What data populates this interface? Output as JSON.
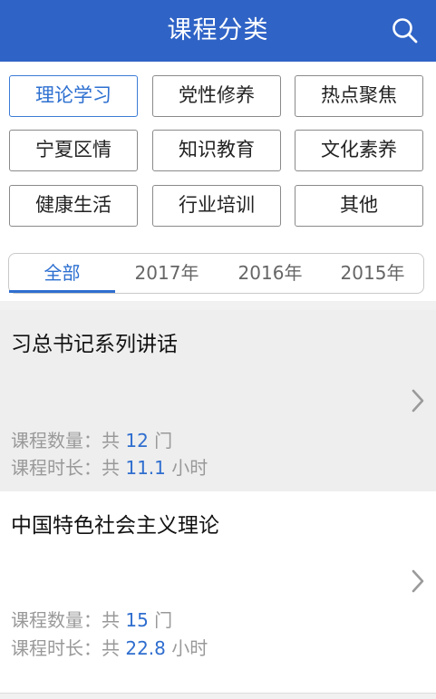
{
  "header": {
    "title": "课程分类",
    "bg_color": "#2f63c6"
  },
  "search": {
    "icon": "search-icon"
  },
  "categories": [
    {
      "label": "理论学习",
      "active": true
    },
    {
      "label": "党性修养",
      "active": false
    },
    {
      "label": "热点聚焦",
      "active": false
    },
    {
      "label": "宁夏区情",
      "active": false
    },
    {
      "label": "知识教育",
      "active": false
    },
    {
      "label": "文化素养",
      "active": false
    },
    {
      "label": "健康生活",
      "active": false
    },
    {
      "label": "行业培训",
      "active": false
    },
    {
      "label": "其他",
      "active": false
    }
  ],
  "year_tabs": [
    {
      "label": "全部",
      "active": true
    },
    {
      "label": "2017年",
      "active": false
    },
    {
      "label": "2016年",
      "active": false
    },
    {
      "label": "2015年",
      "active": false
    }
  ],
  "courses": [
    {
      "title": "习总书记系列讲话",
      "count_label": "课程数量：",
      "count_prefix": "共",
      "count_value": "12",
      "count_unit": "门",
      "duration_label": "课程时长：",
      "duration_prefix": "共",
      "duration_value": "11.1",
      "duration_unit": "小时"
    },
    {
      "title": "中国特色社会主义理论",
      "count_label": "课程数量：",
      "count_prefix": "共",
      "count_value": "15",
      "count_unit": "门",
      "duration_label": "课程时长：",
      "duration_prefix": "共",
      "duration_value": "22.8",
      "duration_unit": "小时"
    }
  ],
  "colors": {
    "accent": "#2f6ecf",
    "active_border": "#3b7bd6",
    "muted_text": "#999999"
  }
}
